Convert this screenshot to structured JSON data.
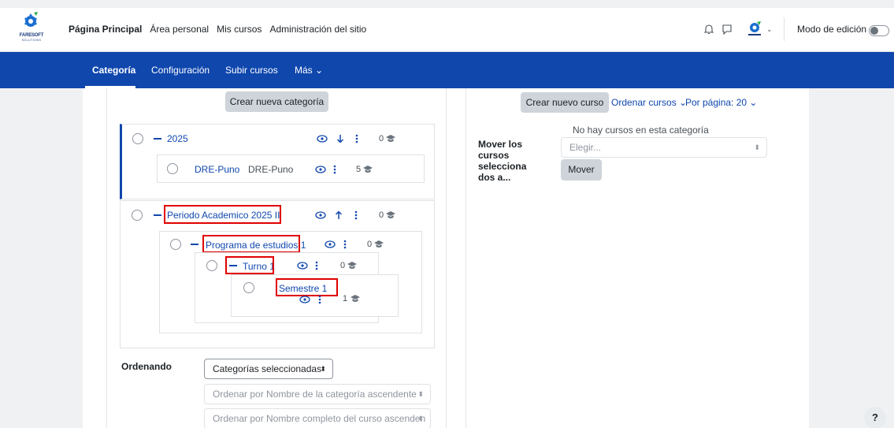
{
  "brand": {
    "name": "FARESOFT",
    "tagline": "SOLUTIONS"
  },
  "primary_nav": [
    "Página Principal",
    "Área personal",
    "Mis cursos",
    "Administración del sitio"
  ],
  "edit_mode_label": "Modo de edición",
  "secondary_nav": {
    "tabs": [
      "Categoría",
      "Configuración",
      "Subir cursos"
    ],
    "more": "Más ⌄"
  },
  "left": {
    "create_category": "Crear nueva categoría",
    "categories": {
      "c2025": {
        "name": "2025",
        "count": "0"
      },
      "dre": {
        "name": "DRE-Puno",
        "idnumber": "DRE-Puno",
        "count": "5"
      },
      "periodo": {
        "name": "Periodo Academico 2025 II",
        "count": "0"
      },
      "programa": {
        "name": "Programa de estudios 1",
        "count": "0"
      },
      "turno": {
        "name": "Turno 1",
        "count": "0"
      },
      "semestre": {
        "name": "Semestre 1",
        "count": "1"
      }
    },
    "sorting": {
      "label": "Ordenando",
      "scope_select": "Categorías seleccionadas",
      "category_sort": "Ordenar por Nombre de la categoría ascendente",
      "course_sort": "Ordenar por Nombre completo del curso ascenden"
    }
  },
  "right": {
    "create_course": "Crear nuevo curso",
    "sort_courses": "Ordenar cursos ⌄",
    "per_page": "Por página: 20 ⌄",
    "empty": "No hay cursos en esta categoría",
    "move_label_lines": [
      "Mover los",
      "cursos",
      "selecciona",
      "dos a..."
    ],
    "choose_placeholder": "Elegir...",
    "move_button": "Mover"
  },
  "help": "?",
  "colors": {
    "brand_blue": "#0f47ad",
    "highlight_red": "#e00000"
  }
}
